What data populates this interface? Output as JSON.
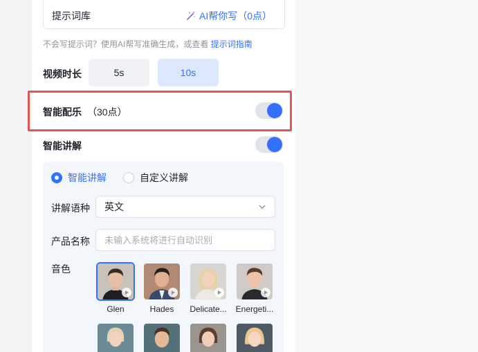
{
  "prompt_library": {
    "label": "提示词库",
    "ai_write": "AI帮你写（0点）"
  },
  "hint": {
    "text": "不会写提示词？使用AI帮写准确生成，或查看 ",
    "link": "提示词指南"
  },
  "duration": {
    "label": "视频时长",
    "options": [
      "5s",
      "10s"
    ],
    "selected": "10s"
  },
  "smart_music": {
    "label": "智能配乐",
    "cost": "（30点）",
    "enabled": true
  },
  "smart_narration": {
    "label": "智能讲解",
    "enabled": true,
    "modes": [
      "智能讲解",
      "自定义讲解"
    ],
    "selected_mode": "智能讲解",
    "language_label": "讲解语种",
    "language_value": "英文",
    "product_label": "产品名称",
    "product_placeholder": "未输入系统将进行自动识别",
    "voice_label": "音色",
    "voices": [
      {
        "name": "Glen",
        "selected": true
      },
      {
        "name": "Hades",
        "selected": false
      },
      {
        "name": "Delicate...",
        "selected": false
      },
      {
        "name": "Energeti...",
        "selected": false
      }
    ]
  },
  "colors": {
    "accent": "#3370ff",
    "highlight": "#e25555"
  }
}
